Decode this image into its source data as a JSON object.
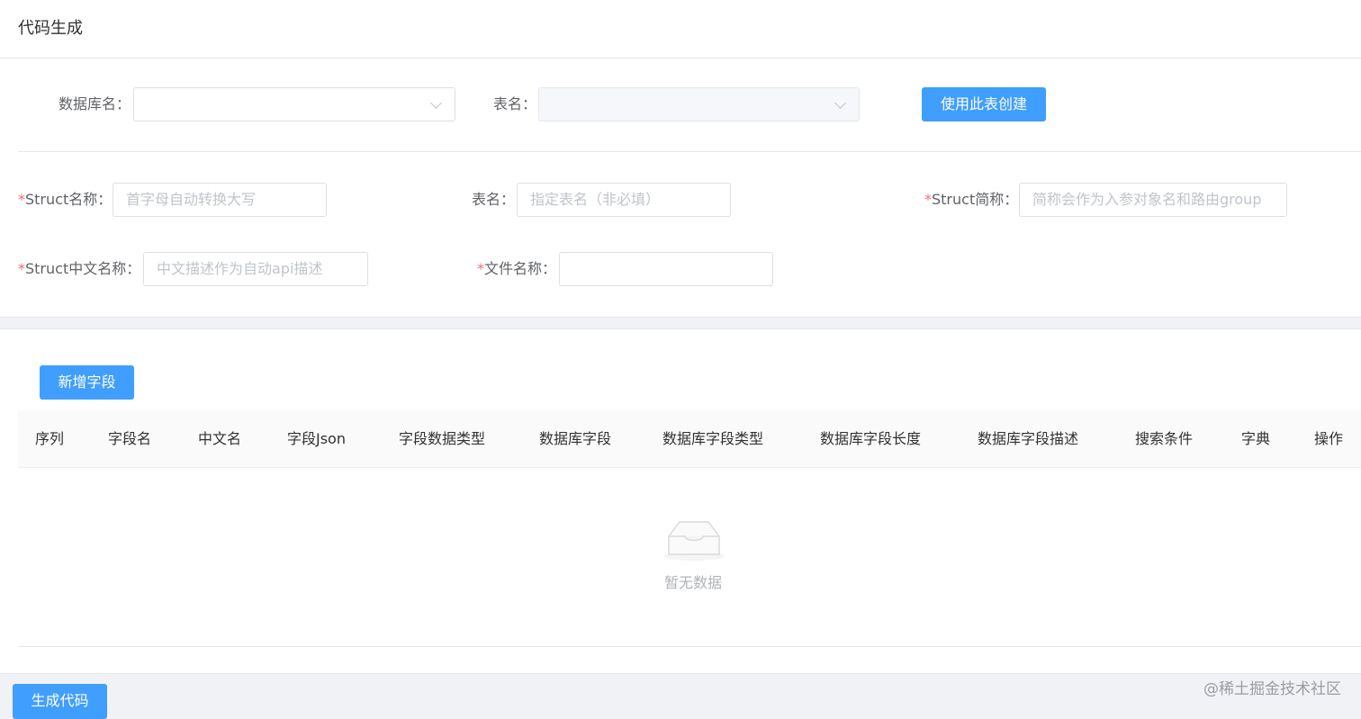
{
  "page": {
    "title": "代码生成"
  },
  "db_select": {
    "db_label": "数据库名",
    "db_value": "",
    "table_label": "表名",
    "table_value": "",
    "create_button": "使用此表创建"
  },
  "form": {
    "struct_name_label": "Struct名称",
    "struct_name_placeholder": "首字母自动转换大写",
    "table_name_label": "表名",
    "table_name_placeholder": "指定表名（非必填）",
    "struct_abbr_label": "Struct简称",
    "struct_abbr_placeholder": "简称会作为入参对象名和路由group",
    "struct_cn_label": "Struct中文名称",
    "struct_cn_placeholder": "中文描述作为自动api描述",
    "file_name_label": "文件名称",
    "file_name_value": ""
  },
  "fields": {
    "add_button": "新增字段",
    "columns": [
      "序列",
      "字段名",
      "中文名",
      "字段Json",
      "字段数据类型",
      "数据库字段",
      "数据库字段类型",
      "数据库字段长度",
      "数据库字段描述",
      "搜索条件",
      "字典",
      "操作"
    ],
    "empty_text": "暂无数据"
  },
  "footer": {
    "generate_button": "生成代码",
    "watermark": "@稀土掘金技术社区"
  },
  "colors": {
    "primary": "#409eff",
    "required": "#f56c6c",
    "border": "#dcdfe6"
  },
  "icons": {
    "select_arrow": "chevron-down-icon",
    "empty": "empty-box-icon"
  }
}
